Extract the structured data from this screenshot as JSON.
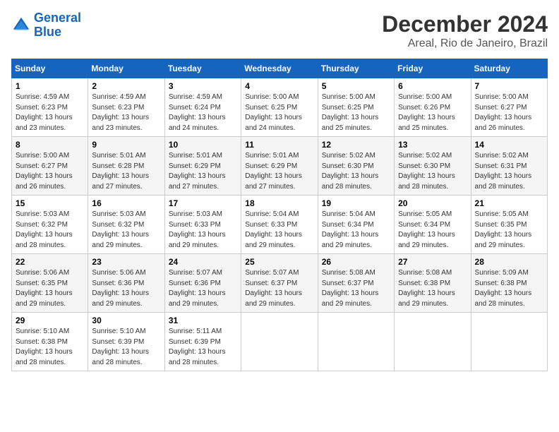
{
  "header": {
    "logo_line1": "General",
    "logo_line2": "Blue",
    "title": "December 2024",
    "subtitle": "Areal, Rio de Janeiro, Brazil"
  },
  "calendar": {
    "weekdays": [
      "Sunday",
      "Monday",
      "Tuesday",
      "Wednesday",
      "Thursday",
      "Friday",
      "Saturday"
    ],
    "weeks": [
      [
        {
          "day": "1",
          "info": "Sunrise: 4:59 AM\nSunset: 6:23 PM\nDaylight: 13 hours\nand 23 minutes."
        },
        {
          "day": "2",
          "info": "Sunrise: 4:59 AM\nSunset: 6:23 PM\nDaylight: 13 hours\nand 23 minutes."
        },
        {
          "day": "3",
          "info": "Sunrise: 4:59 AM\nSunset: 6:24 PM\nDaylight: 13 hours\nand 24 minutes."
        },
        {
          "day": "4",
          "info": "Sunrise: 5:00 AM\nSunset: 6:25 PM\nDaylight: 13 hours\nand 24 minutes."
        },
        {
          "day": "5",
          "info": "Sunrise: 5:00 AM\nSunset: 6:25 PM\nDaylight: 13 hours\nand 25 minutes."
        },
        {
          "day": "6",
          "info": "Sunrise: 5:00 AM\nSunset: 6:26 PM\nDaylight: 13 hours\nand 25 minutes."
        },
        {
          "day": "7",
          "info": "Sunrise: 5:00 AM\nSunset: 6:27 PM\nDaylight: 13 hours\nand 26 minutes."
        }
      ],
      [
        {
          "day": "8",
          "info": "Sunrise: 5:00 AM\nSunset: 6:27 PM\nDaylight: 13 hours\nand 26 minutes."
        },
        {
          "day": "9",
          "info": "Sunrise: 5:01 AM\nSunset: 6:28 PM\nDaylight: 13 hours\nand 27 minutes."
        },
        {
          "day": "10",
          "info": "Sunrise: 5:01 AM\nSunset: 6:29 PM\nDaylight: 13 hours\nand 27 minutes."
        },
        {
          "day": "11",
          "info": "Sunrise: 5:01 AM\nSunset: 6:29 PM\nDaylight: 13 hours\nand 27 minutes."
        },
        {
          "day": "12",
          "info": "Sunrise: 5:02 AM\nSunset: 6:30 PM\nDaylight: 13 hours\nand 28 minutes."
        },
        {
          "day": "13",
          "info": "Sunrise: 5:02 AM\nSunset: 6:30 PM\nDaylight: 13 hours\nand 28 minutes."
        },
        {
          "day": "14",
          "info": "Sunrise: 5:02 AM\nSunset: 6:31 PM\nDaylight: 13 hours\nand 28 minutes."
        }
      ],
      [
        {
          "day": "15",
          "info": "Sunrise: 5:03 AM\nSunset: 6:32 PM\nDaylight: 13 hours\nand 28 minutes."
        },
        {
          "day": "16",
          "info": "Sunrise: 5:03 AM\nSunset: 6:32 PM\nDaylight: 13 hours\nand 29 minutes."
        },
        {
          "day": "17",
          "info": "Sunrise: 5:03 AM\nSunset: 6:33 PM\nDaylight: 13 hours\nand 29 minutes."
        },
        {
          "day": "18",
          "info": "Sunrise: 5:04 AM\nSunset: 6:33 PM\nDaylight: 13 hours\nand 29 minutes."
        },
        {
          "day": "19",
          "info": "Sunrise: 5:04 AM\nSunset: 6:34 PM\nDaylight: 13 hours\nand 29 minutes."
        },
        {
          "day": "20",
          "info": "Sunrise: 5:05 AM\nSunset: 6:34 PM\nDaylight: 13 hours\nand 29 minutes."
        },
        {
          "day": "21",
          "info": "Sunrise: 5:05 AM\nSunset: 6:35 PM\nDaylight: 13 hours\nand 29 minutes."
        }
      ],
      [
        {
          "day": "22",
          "info": "Sunrise: 5:06 AM\nSunset: 6:35 PM\nDaylight: 13 hours\nand 29 minutes."
        },
        {
          "day": "23",
          "info": "Sunrise: 5:06 AM\nSunset: 6:36 PM\nDaylight: 13 hours\nand 29 minutes."
        },
        {
          "day": "24",
          "info": "Sunrise: 5:07 AM\nSunset: 6:36 PM\nDaylight: 13 hours\nand 29 minutes."
        },
        {
          "day": "25",
          "info": "Sunrise: 5:07 AM\nSunset: 6:37 PM\nDaylight: 13 hours\nand 29 minutes."
        },
        {
          "day": "26",
          "info": "Sunrise: 5:08 AM\nSunset: 6:37 PM\nDaylight: 13 hours\nand 29 minutes."
        },
        {
          "day": "27",
          "info": "Sunrise: 5:08 AM\nSunset: 6:38 PM\nDaylight: 13 hours\nand 29 minutes."
        },
        {
          "day": "28",
          "info": "Sunrise: 5:09 AM\nSunset: 6:38 PM\nDaylight: 13 hours\nand 28 minutes."
        }
      ],
      [
        {
          "day": "29",
          "info": "Sunrise: 5:10 AM\nSunset: 6:38 PM\nDaylight: 13 hours\nand 28 minutes."
        },
        {
          "day": "30",
          "info": "Sunrise: 5:10 AM\nSunset: 6:39 PM\nDaylight: 13 hours\nand 28 minutes."
        },
        {
          "day": "31",
          "info": "Sunrise: 5:11 AM\nSunset: 6:39 PM\nDaylight: 13 hours\nand 28 minutes."
        },
        null,
        null,
        null,
        null
      ]
    ]
  }
}
